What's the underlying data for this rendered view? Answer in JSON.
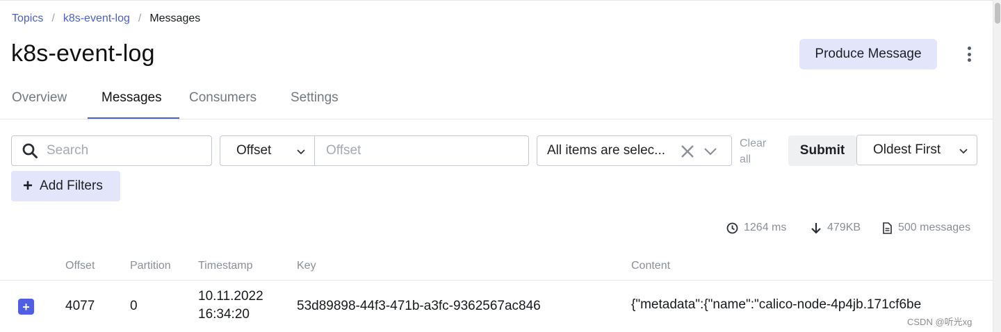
{
  "breadcrumb": {
    "items": [
      "Topics",
      "k8s-event-log",
      "Messages"
    ],
    "separator": "/"
  },
  "page": {
    "title": "k8s-event-log",
    "produce_label": "Produce Message"
  },
  "tabs": [
    {
      "label": "Overview",
      "active": false
    },
    {
      "label": "Messages",
      "active": true
    },
    {
      "label": "Consumers",
      "active": false
    },
    {
      "label": "Settings",
      "active": false
    }
  ],
  "filters": {
    "search_placeholder": "Search",
    "seek_type": "Offset",
    "offset_placeholder": "Offset",
    "partitions_value": "All items are selected.",
    "partitions_display": "All items are selec...",
    "clear_all_line1": "Clear",
    "clear_all_line2": "all",
    "submit_label": "Submit",
    "sort_value": "Oldest First",
    "add_filters_label": "Add Filters"
  },
  "stats": {
    "elapsed": "1264 ms",
    "bytes": "479KB",
    "messages": "500 messages"
  },
  "table": {
    "headers": {
      "offset": "Offset",
      "partition": "Partition",
      "timestamp": "Timestamp",
      "key": "Key",
      "content": "Content"
    },
    "rows": [
      {
        "offset": "4077",
        "partition": "0",
        "timestamp_date": "10.11.2022",
        "timestamp_time": "16:34:20",
        "key": "53d89898-44f3-471b-a3fc-9362567ac846",
        "content": "{\"metadata\":{\"name\":\"calico-node-4p4jb.171cf6be"
      }
    ]
  },
  "watermark": "CSDN @听光xg",
  "colors": {
    "accent": "#4c5fc3",
    "button_light": "#e3e6fb",
    "expand": "#4f5ee2",
    "muted_text": "#8a8f96"
  },
  "icons": {
    "search": "search-icon",
    "chevron": "chevron-down-icon",
    "clear": "close-icon",
    "clock": "clock-icon",
    "download": "arrow-down-icon",
    "file": "file-icon",
    "kebab": "kebab-menu-icon",
    "expand": "plus-square-icon"
  }
}
